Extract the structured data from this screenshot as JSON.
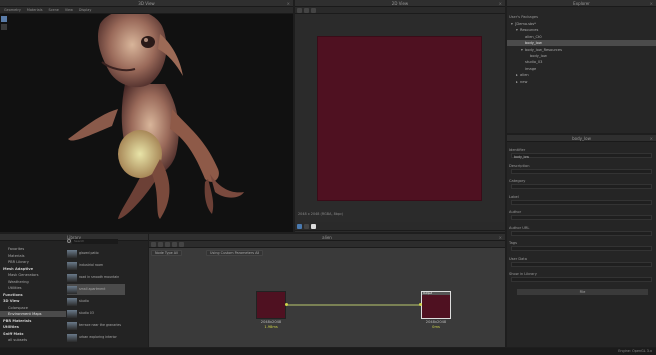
{
  "view3d": {
    "title": "3D View",
    "menus": [
      "Geometry",
      "Materials",
      "Scene",
      "View",
      "Display"
    ],
    "side_icons": [
      "cursor-icon",
      "hand-icon"
    ]
  },
  "view2d": {
    "title": "2D View",
    "resolution_label": "2048 x 2048 (RGBA, 8bpc)",
    "texture_color": "#4f1121"
  },
  "explorer": {
    "title": "Explorer",
    "section": "User's Packages",
    "items": [
      {
        "label": "[Demo.sbs*",
        "depth": 0,
        "expand": "▾",
        "selected": false
      },
      {
        "label": "Resources",
        "depth": 1,
        "expand": "▾",
        "selected": false
      },
      {
        "label": "alien_Ct0",
        "depth": 2,
        "expand": "",
        "selected": false
      },
      {
        "label": "body_low",
        "depth": 2,
        "expand": "",
        "selected": true
      },
      {
        "label": "body_low_Resources",
        "depth": 2,
        "expand": "▾",
        "selected": false
      },
      {
        "label": "body_low",
        "depth": 3,
        "expand": "",
        "selected": false
      },
      {
        "label": "studio_03",
        "depth": 2,
        "expand": "",
        "selected": false
      },
      {
        "label": "image",
        "depth": 2,
        "expand": "",
        "selected": false
      },
      {
        "label": "alien",
        "depth": 1,
        "expand": "▸",
        "selected": false
      },
      {
        "label": "new",
        "depth": 1,
        "expand": "▸",
        "selected": false
      }
    ]
  },
  "properties": {
    "title": "body_low",
    "fields": [
      {
        "label": "Identifier",
        "value": "body_low"
      },
      {
        "label": "Description",
        "value": ""
      },
      {
        "label": "Category",
        "value": ""
      },
      {
        "label": "Label",
        "value": ""
      },
      {
        "label": "Author",
        "value": ""
      },
      {
        "label": "Author URL",
        "value": ""
      },
      {
        "label": "Tags",
        "value": ""
      },
      {
        "label": "User Data",
        "value": ""
      },
      {
        "label": "Show in Library",
        "value": ""
      }
    ],
    "file_button": "File"
  },
  "library": {
    "title": "Library",
    "search_placeholder": "Search",
    "categories": [
      {
        "label": "Favorites",
        "bold": false,
        "selected": false
      },
      {
        "label": "Materials",
        "bold": false,
        "selected": false
      },
      {
        "label": "PBR Library",
        "bold": false,
        "selected": false
      },
      {
        "label": "Mesh Adaptive",
        "bold": true,
        "selected": false
      },
      {
        "label": "Mask Generators",
        "bold": false,
        "selected": false
      },
      {
        "label": "Weathering",
        "bold": false,
        "selected": false
      },
      {
        "label": "Utilities",
        "bold": false,
        "selected": false
      },
      {
        "label": "Functions",
        "bold": true,
        "selected": false
      },
      {
        "label": "3D View",
        "bold": true,
        "selected": false
      },
      {
        "label": "Colorspace",
        "bold": false,
        "selected": false
      },
      {
        "label": "Environment Maps",
        "bold": false,
        "selected": true
      },
      {
        "label": "PBR Materials",
        "bold": true,
        "selected": false
      },
      {
        "label": "Utilities",
        "bold": true,
        "selected": false
      },
      {
        "label": "Sniff Matx",
        "bold": true,
        "selected": false
      },
      {
        "label": "all subsets",
        "bold": false,
        "selected": false
      }
    ],
    "items": [
      {
        "label": "glazed patio",
        "selected": false
      },
      {
        "label": "industrial room",
        "selected": false
      },
      {
        "label": "road in smooth mountain",
        "selected": false
      },
      {
        "label": "small apartment",
        "selected": true
      },
      {
        "label": "studio",
        "selected": false
      },
      {
        "label": "studio 03",
        "selected": false
      },
      {
        "label": "terrace near the granaries",
        "selected": false
      },
      {
        "label": "urban exploring interior",
        "selected": false
      }
    ]
  },
  "graph": {
    "title": "alien",
    "node_type_label": "Node Type",
    "node_type_value": "All",
    "params_label": "Using Custom Parameters",
    "params_value": "All",
    "node_a": {
      "size": "2048x2048",
      "time": "1.98ms"
    },
    "node_b": {
      "size": "2048x2048",
      "time": "0ms",
      "label": "Output"
    }
  },
  "status": {
    "engine": "Engine: OpenGL 3.x"
  },
  "colors": {
    "accent": "#cfd44a",
    "wire": "#b9c86d",
    "texture": "#4f1121"
  }
}
